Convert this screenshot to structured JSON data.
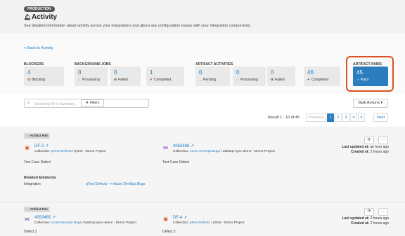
{
  "header": {
    "environment": "PRODUCTION",
    "title": "Activity",
    "subtitle": "See detailed information about activity across your integrations and about any configuration issues with your integration components.",
    "back_link": "< Back to Activity"
  },
  "stats": {
    "blockers": {
      "label": "BLOCKERS",
      "items": [
        {
          "value": "4",
          "text": "Blocking",
          "icon": "⊘"
        }
      ]
    },
    "background_jobs": {
      "label": "BACKGROUND JOBS",
      "items": [
        {
          "value": "0",
          "text": "Processing",
          "icon": "◌"
        },
        {
          "value": "0",
          "text": "Failed",
          "icon": "⊗"
        },
        {
          "value": "1",
          "text": "Completed",
          "icon": "✔"
        }
      ]
    },
    "artifact_activities": {
      "label": "ARTIFACT ACTIVITIES",
      "items": [
        {
          "value": "0",
          "text": "Pending",
          "icon": "…"
        },
        {
          "value": "0",
          "text": "Processing",
          "icon": "◌"
        },
        {
          "value": "0",
          "text": "Failed",
          "icon": "⊗"
        },
        {
          "value": "46",
          "text": "Completed",
          "icon": "✔"
        }
      ]
    },
    "artifact_pairs": {
      "label": "ARTIFACT PAIRS",
      "items": [
        {
          "value": "45",
          "text": "Pairs",
          "icon": "⇔"
        }
      ]
    }
  },
  "toolbar": {
    "search_placeholder": "Search by ID or Summary",
    "filters_label": "Filters",
    "bulk_actions_label": "Bulk Actions",
    "result_text": "Result 1 - 10 of 45",
    "pagination": [
      "Previous",
      "1",
      "2",
      "3",
      "4",
      "5",
      "Next"
    ]
  },
  "pairs": [
    {
      "tag": "Artifact Pair",
      "left": {
        "id": "DF-2",
        "collection_prefix": "Collection: ",
        "collection": "qTest Defects",
        "collection_suffix": " / qTest - Demo Project",
        "type": "Test Case Defect"
      },
      "right": {
        "id": "4053486",
        "collection_prefix": "Collection: ",
        "collection": "Azure DevOps Bugs",
        "collection_suffix": " / tasktop-sync-demo - Demo Project",
        "type": "Test Case Defect"
      },
      "last_updated_label": "Last updated at:",
      "last_updated": "an hour ago",
      "created_label": "Created at:",
      "created": "2 hours ago",
      "related_heading": "Related Elements",
      "related_key": "Integration",
      "related_value": "qTest Defects --> Azure DevOps Bugs"
    },
    {
      "tag": "Artifact Pair",
      "left": {
        "id": "4053465",
        "collection_prefix": "Collection: ",
        "collection": "Azure DevOps Bugs",
        "collection_suffix": " / tasktop-sync-demo - Demo Project",
        "type": "Defect 2"
      },
      "right": {
        "id": "DF-4",
        "collection_prefix": "Collection: ",
        "collection": "qTest Defects",
        "collection_suffix": " / qTest - Demo Project",
        "type": "Defect 2"
      },
      "last_updated_label": "Last updated at:",
      "last_updated": "2 hours ago",
      "created_label": "Created at:",
      "created": "2 hours ago"
    }
  ],
  "colors": {
    "accent": "#2a7dbf",
    "link": "#1a7bc4",
    "highlight": "#d9531e",
    "qtest": "#e2531f",
    "azure": "#7b3fb5"
  }
}
